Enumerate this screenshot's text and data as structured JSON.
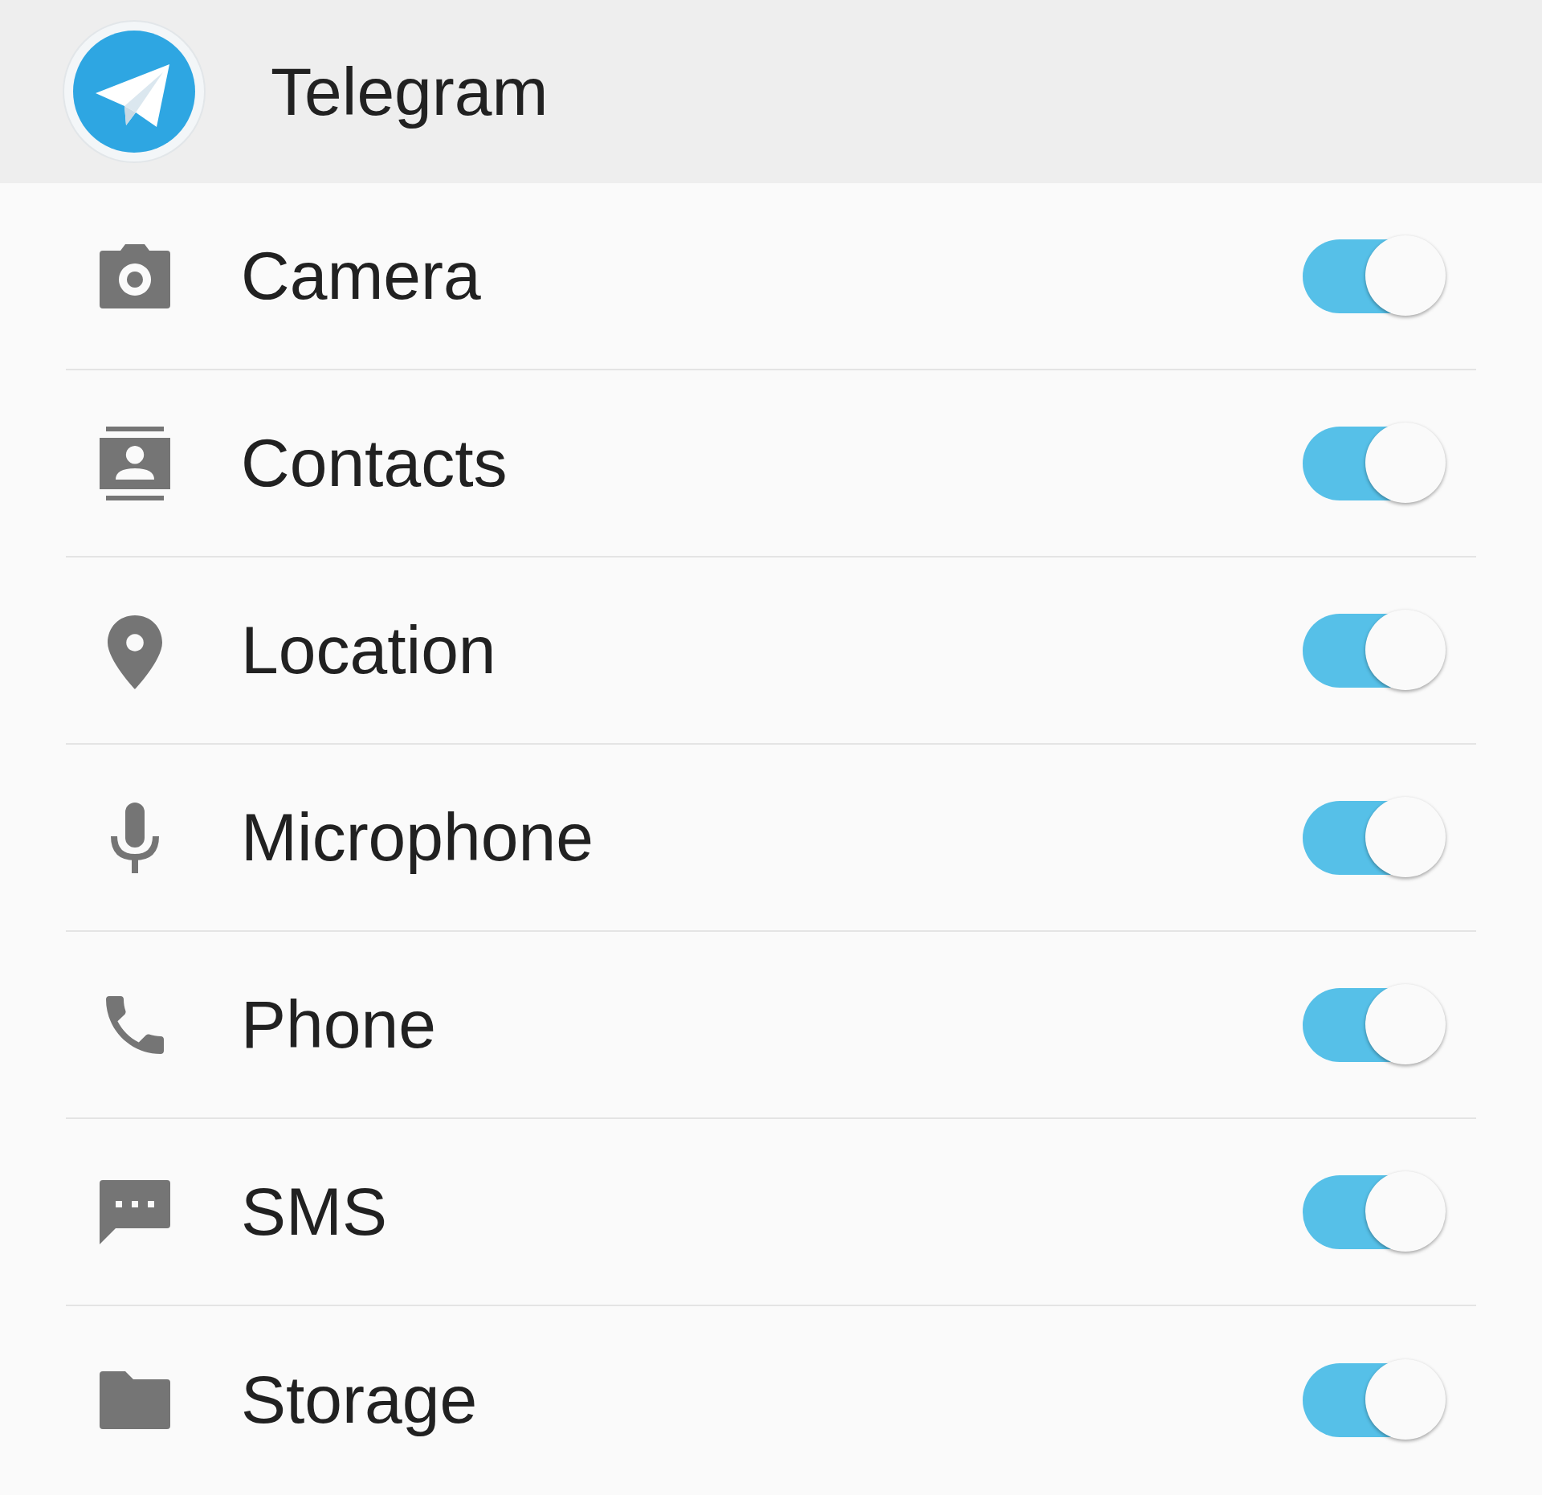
{
  "app": {
    "title": "Telegram"
  },
  "permissions": [
    {
      "label": "Camera",
      "on": true
    },
    {
      "label": "Contacts",
      "on": true
    },
    {
      "label": "Location",
      "on": true
    },
    {
      "label": "Microphone",
      "on": true
    },
    {
      "label": "Phone",
      "on": true
    },
    {
      "label": "SMS",
      "on": true
    },
    {
      "label": "Storage",
      "on": true
    }
  ]
}
